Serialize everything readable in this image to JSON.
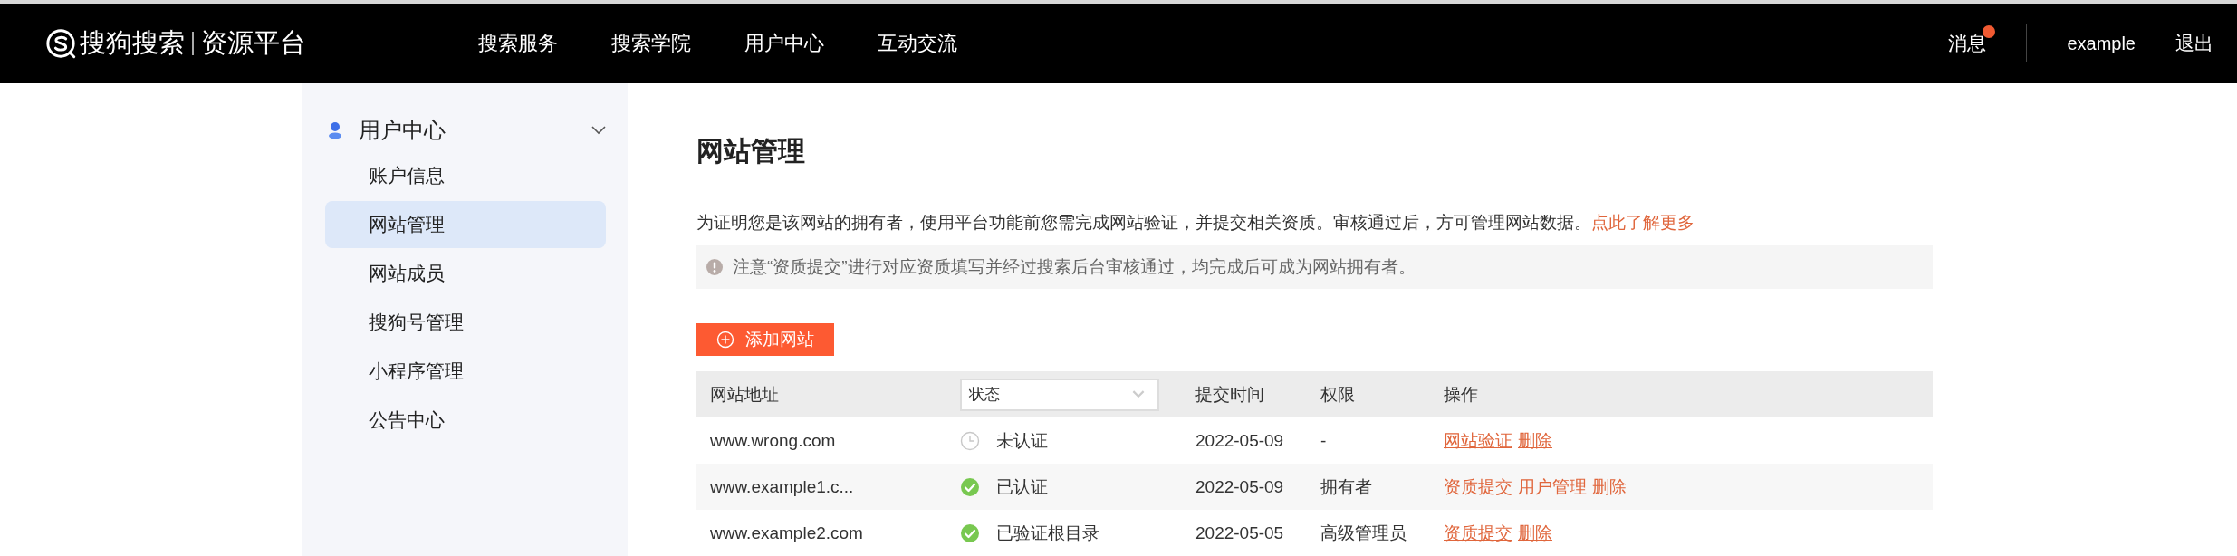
{
  "header": {
    "brand": "搜狗搜索",
    "product": "资源平台",
    "nav": [
      {
        "label": "搜索服务"
      },
      {
        "label": "搜索学院"
      },
      {
        "label": "用户中心"
      },
      {
        "label": "互动交流"
      }
    ],
    "messages": {
      "label": "消息",
      "unread": true
    },
    "user": "example",
    "logout": "退出"
  },
  "sidebar": {
    "section": {
      "label": "用户中心",
      "expanded": true
    },
    "items": [
      {
        "label": "账户信息",
        "selected": false
      },
      {
        "label": "网站管理",
        "selected": true
      },
      {
        "label": "网站成员",
        "selected": false
      },
      {
        "label": "搜狗号管理",
        "selected": false
      },
      {
        "label": "小程序管理",
        "selected": false
      },
      {
        "label": "公告中心",
        "selected": false
      }
    ]
  },
  "page": {
    "title": "网站管理",
    "description": "为证明您是该网站的拥有者，使用平台功能前您需完成网站验证，并提交相关资质。审核通过后，方可管理网站数据。",
    "learn_more": "点此了解更多",
    "notice": "注意“资质提交”进行对应资质填写并经过搜索后台审核通过，均完成后可成为网站拥有者。",
    "add_button": "添加网站"
  },
  "table": {
    "columns": {
      "address": "网站地址",
      "status_filter": "状态",
      "time": "提交时间",
      "rights": "权限",
      "actions": "操作"
    },
    "rows": [
      {
        "address": "www.wrong.com",
        "kind": "pending",
        "status": "未认证",
        "time": "2022-05-09",
        "rights": "-",
        "actions": [
          "网站验证",
          "删除"
        ]
      },
      {
        "address": "www.example1.c...",
        "kind": "verified",
        "status": "已认证",
        "time": "2022-05-09",
        "rights": "拥有者",
        "actions": [
          "资质提交",
          "用户管理",
          "删除"
        ]
      },
      {
        "address": "www.example2.com",
        "kind": "verified",
        "status": "已验证根目录",
        "time": "2022-05-05",
        "rights": "高级管理员",
        "actions": [
          "资质提交",
          "删除"
        ]
      }
    ]
  }
}
